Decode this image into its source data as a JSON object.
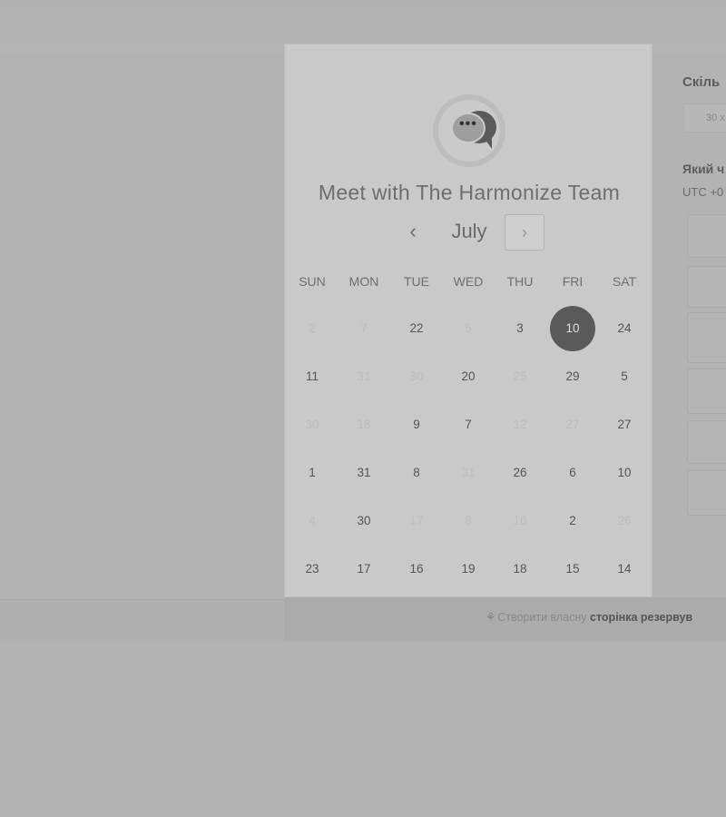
{
  "background_color": "#b3b3b3",
  "top_glyphs": "",
  "scheduler": {
    "title": "Meet with The Harmonize Team",
    "month": "July",
    "prev_icon": "‹",
    "next_icon": "›",
    "weekdays": [
      "SUN",
      "MON",
      "TUE",
      "WED",
      "THU",
      "FRI",
      "SAT"
    ],
    "selected_color": "#5a5a5a",
    "weeks": [
      [
        {
          "d": "2",
          "m": true
        },
        {
          "d": "7",
          "m": true
        },
        {
          "d": "22"
        },
        {
          "d": "5",
          "m": true
        },
        {
          "d": "3"
        },
        {
          "d": "10",
          "s": true
        },
        {
          "d": "24"
        }
      ],
      [
        {
          "d": "11"
        },
        {
          "d": "31",
          "m": true
        },
        {
          "d": "30",
          "m": true
        },
        {
          "d": "20"
        },
        {
          "d": "25",
          "m": true
        },
        {
          "d": "29"
        },
        {
          "d": "5"
        }
      ],
      [
        {
          "d": "30",
          "m": true
        },
        {
          "d": "18",
          "m": true
        },
        {
          "d": "9"
        },
        {
          "d": "7"
        },
        {
          "d": "12",
          "m": true
        },
        {
          "d": "27",
          "m": true
        },
        {
          "d": "27"
        }
      ],
      [
        {
          "d": "1"
        },
        {
          "d": "31"
        },
        {
          "d": "8"
        },
        {
          "d": "31",
          "m": true
        },
        {
          "d": "26"
        },
        {
          "d": "6"
        },
        {
          "d": "10"
        }
      ],
      [
        {
          "d": "4",
          "m": true
        },
        {
          "d": "30"
        },
        {
          "d": "17",
          "m": true
        },
        {
          "d": "8",
          "m": true
        },
        {
          "d": "16",
          "m": true
        },
        {
          "d": "2"
        },
        {
          "d": "26",
          "m": true
        }
      ],
      [
        {
          "d": "23"
        },
        {
          "d": "17"
        },
        {
          "d": "16"
        },
        {
          "d": "19"
        },
        {
          "d": "18"
        },
        {
          "d": "15"
        },
        {
          "d": "14"
        }
      ]
    ]
  },
  "side_panel": {
    "duration_label": "Скіль",
    "duration_value": "30 x",
    "time_label": "Який ч",
    "timezone": "UTC +0"
  },
  "footer": {
    "icon": "⚘",
    "text": "Створити власну ",
    "bold": "сторінка резервув"
  }
}
